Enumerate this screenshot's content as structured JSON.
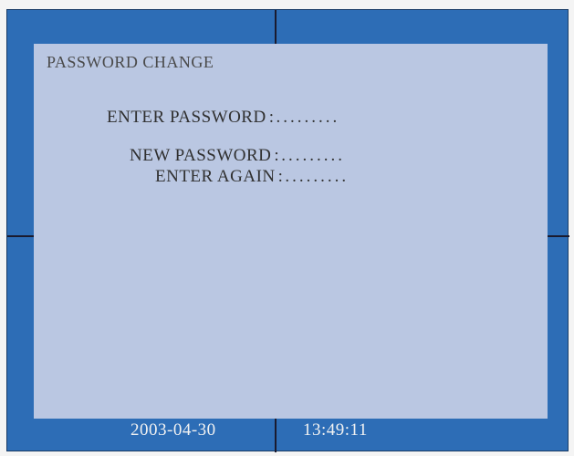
{
  "dialog": {
    "title": "PASSWORD CHANGE",
    "fields": [
      {
        "label": "ENTER PASSWORD",
        "separator": ":",
        "value": "........."
      },
      {
        "label": "NEW PASSWORD",
        "separator": ":",
        "value": "........."
      },
      {
        "label": "ENTER AGAIN",
        "separator": ":",
        "value": "........."
      }
    ]
  },
  "status": {
    "date": "2003-04-30",
    "time": "13:49:11"
  },
  "colors": {
    "screen_background": "#2d6db6",
    "panel_background": "#bac7e2",
    "text": "#303030",
    "status_text": "#f2f2f2"
  }
}
